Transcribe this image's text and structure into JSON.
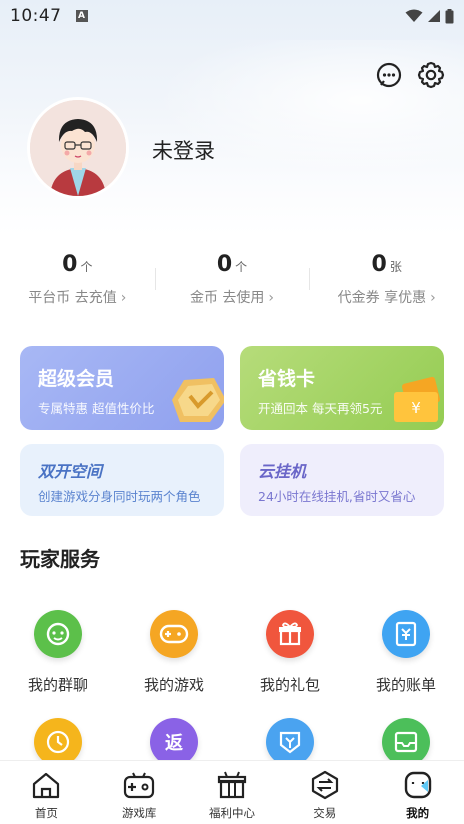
{
  "status_bar": {
    "time": "10:47",
    "notification_badge": "A"
  },
  "profile": {
    "username": "未登录"
  },
  "stats": [
    {
      "value": "0",
      "unit": "个",
      "label": "平台币 去充值"
    },
    {
      "value": "0",
      "unit": "个",
      "label": "金币 去使用"
    },
    {
      "value": "0",
      "unit": "张",
      "label": "代金券 享优惠"
    }
  ],
  "cards": {
    "vip": {
      "title": "超级会员",
      "subtitle": "专属特惠 超值性价比"
    },
    "save": {
      "title": "省钱卡",
      "subtitle": "开通回本 每天再领5元"
    },
    "dual": {
      "title": "双开空间",
      "subtitle": "创建游戏分身同时玩两个角色"
    },
    "cloud": {
      "title": "云挂机",
      "subtitle": "24小时在线挂机,省时又省心"
    }
  },
  "services": {
    "title": "玩家服务",
    "items": [
      {
        "label": "我的群聊",
        "icon": "chat-group-icon",
        "color": "#5cc04a"
      },
      {
        "label": "我的游戏",
        "icon": "gamepad-icon",
        "color": "#f5a623"
      },
      {
        "label": "我的礼包",
        "icon": "gift-icon",
        "color": "#f0563d"
      },
      {
        "label": "我的账单",
        "icon": "bill-icon",
        "color": "#3fa4f2"
      },
      {
        "label": "",
        "icon": "clock-icon",
        "color": "#f5b51c"
      },
      {
        "label": "返",
        "icon": "rebate-icon",
        "color": "#8a62e6"
      },
      {
        "label": "",
        "icon": "coupon-down-icon",
        "color": "#4aa3f0"
      },
      {
        "label": "",
        "icon": "inbox-icon",
        "color": "#4cbf5a"
      }
    ]
  },
  "bottom_nav": [
    {
      "label": "首页",
      "icon": "home-icon",
      "active": false
    },
    {
      "label": "游戏库",
      "icon": "game-library-icon",
      "active": false
    },
    {
      "label": "福利中心",
      "icon": "welfare-gift-icon",
      "active": false
    },
    {
      "label": "交易",
      "icon": "trade-icon",
      "active": false
    },
    {
      "label": "我的",
      "icon": "mine-icon",
      "active": true
    }
  ],
  "colors": {
    "vip": "#97a8f0",
    "save": "#a2d262",
    "accent_text": "#222222"
  }
}
